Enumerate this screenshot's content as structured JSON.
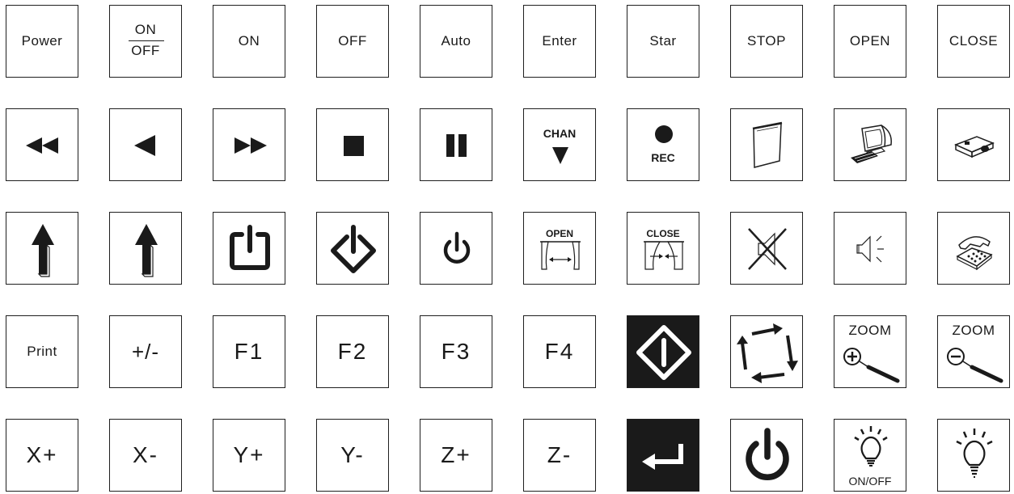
{
  "keys": {
    "power": "Power",
    "on_off_top": "ON",
    "on_off_bottom": "OFF",
    "on": "ON",
    "off": "OFF",
    "auto": "Auto",
    "enter": "Enter",
    "star": "Star",
    "stop": "STOP",
    "open": "OPEN",
    "close": "CLOSE",
    "chan": "CHAN",
    "rec": "REC",
    "curtain_open": "OPEN",
    "curtain_close": "CLOSE",
    "print": "Print",
    "plus_minus": "+/-",
    "f1": "F1",
    "f2": "F2",
    "f3": "F3",
    "f4": "F4",
    "zoom_in": "ZOOM",
    "zoom_out": "ZOOM",
    "x_plus": "X+",
    "x_minus": "X-",
    "y_plus": "Y+",
    "y_minus": "Y-",
    "z_plus": "Z+",
    "z_minus": "Z-",
    "light_on_off": "ON/OFF"
  },
  "icons": {
    "row2": [
      "rewind-icon",
      "play-reverse-icon",
      "fast-forward-icon",
      "stop-square-icon",
      "pause-icon",
      "chan-down-icon",
      "record-icon",
      "projection-screen-icon",
      "computer-icon",
      "projector-icon"
    ],
    "row3": [
      "up-arrow-icon",
      "up-arrow-icon",
      "power-open-icon",
      "power-diamond-icon",
      "power-icon",
      "curtain-open-icon",
      "curtain-close-icon",
      "mute-icon",
      "speaker-icon",
      "telephone-icon"
    ],
    "row4": [
      "start-diamond-icon",
      "cycle-arrows-icon",
      "zoom-in-icon",
      "zoom-out-icon"
    ],
    "row5": [
      "enter-return-icon",
      "power-large-icon",
      "light-bulb-icon",
      "light-bulb-icon"
    ]
  },
  "colors": {
    "stroke": "#1f1f1f",
    "dark_key": "#1a1a1a",
    "background": "#ffffff"
  }
}
